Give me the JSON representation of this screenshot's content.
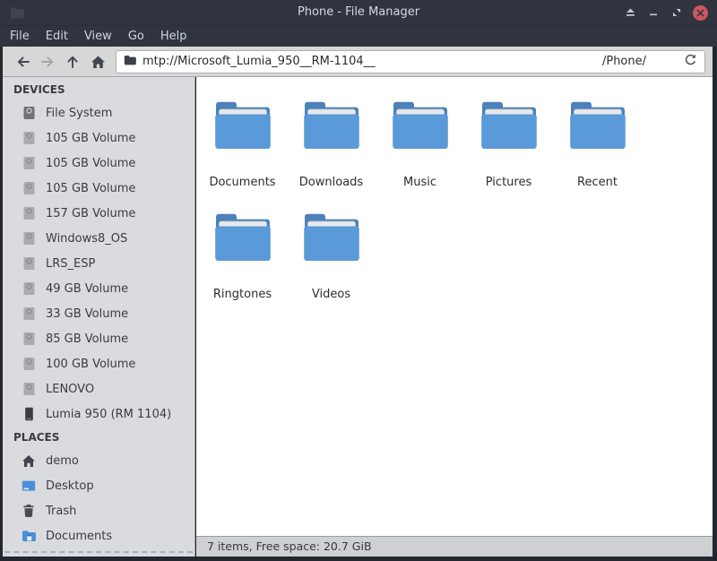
{
  "window": {
    "title": "Phone - File Manager",
    "controls": {
      "eject": "eject",
      "minimize": "minimize",
      "restore": "restore",
      "close": "close"
    }
  },
  "menu": {
    "items": [
      "File",
      "Edit",
      "View",
      "Go",
      "Help"
    ]
  },
  "toolbar": {
    "path": "mtp://Microsoft_Lumia_950__RM-1104__",
    "path_suffix": "/Phone/",
    "buttons": [
      "back",
      "forward",
      "up",
      "home"
    ]
  },
  "sidebar": {
    "sections": [
      {
        "title": "DEVICES",
        "items": [
          {
            "label": "File System",
            "icon": "drive-dark"
          },
          {
            "label": "105 GB Volume",
            "icon": "drive"
          },
          {
            "label": "105 GB Volume",
            "icon": "drive"
          },
          {
            "label": "105 GB Volume",
            "icon": "drive"
          },
          {
            "label": "157 GB Volume",
            "icon": "drive"
          },
          {
            "label": "Windows8_OS",
            "icon": "drive"
          },
          {
            "label": "LRS_ESP",
            "icon": "drive"
          },
          {
            "label": "49 GB Volume",
            "icon": "drive"
          },
          {
            "label": "33 GB Volume",
            "icon": "drive"
          },
          {
            "label": "85 GB Volume",
            "icon": "drive"
          },
          {
            "label": "100 GB Volume",
            "icon": "drive"
          },
          {
            "label": "LENOVO",
            "icon": "drive"
          },
          {
            "label": "Lumia 950 (RM 1104)",
            "icon": "phone"
          }
        ]
      },
      {
        "title": "PLACES",
        "items": [
          {
            "label": "demo",
            "icon": "home"
          },
          {
            "label": "Desktop",
            "icon": "desktop"
          },
          {
            "label": "Trash",
            "icon": "trash"
          },
          {
            "label": "Documents",
            "icon": "folder-small"
          }
        ]
      }
    ]
  },
  "main": {
    "folders": [
      "Documents",
      "Downloads",
      "Music",
      "Pictures",
      "Recent",
      "Ringtones",
      "Videos"
    ]
  },
  "statusbar": {
    "text": "7 items, Free space: 20.7 GiB"
  },
  "colors": {
    "titlebar_bg": "#2f343f",
    "folder_front": "#5b9ad8",
    "folder_back": "#4d81bb",
    "close_button": "#cc575d",
    "accent_blue": "#4a90d9"
  }
}
